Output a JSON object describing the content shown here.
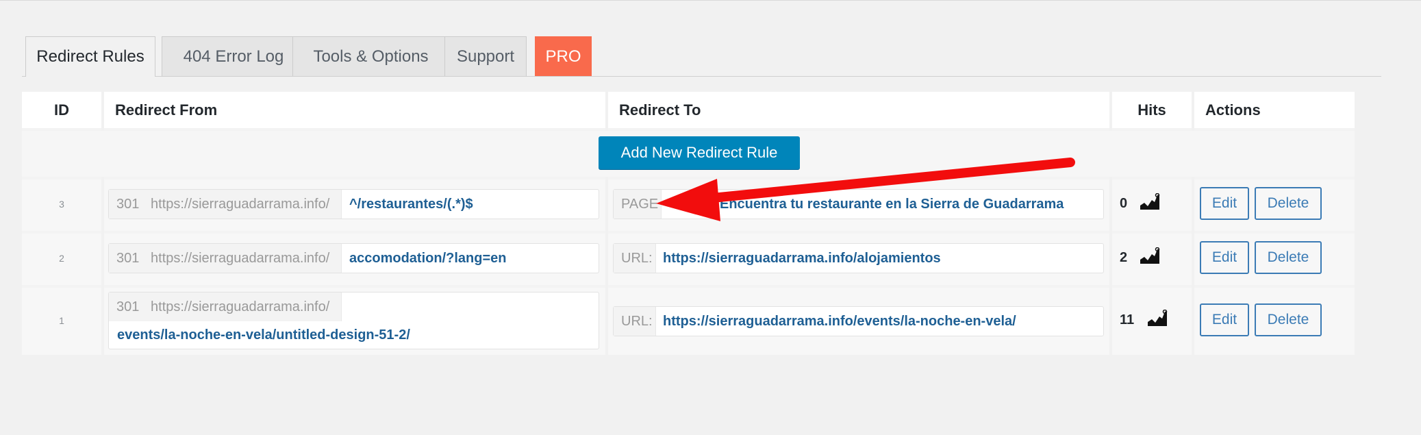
{
  "tabs": [
    {
      "label": "Redirect Rules",
      "active": true
    },
    {
      "label": "404 Error Log"
    },
    {
      "label": "Tools & Options"
    },
    {
      "label": "Support"
    },
    {
      "label": "PRO"
    }
  ],
  "table": {
    "headers": {
      "id": "ID",
      "from": "Redirect From",
      "to": "Redirect To",
      "hits": "Hits",
      "actions": "Actions"
    },
    "add_button": "Add New Redirect Rule",
    "rows": [
      {
        "id": "3",
        "status": "301",
        "base": "https://sierraguadarrama.info/",
        "from": "^/restaurantes/(.*)$",
        "to_type": "PAGE",
        "to": "Encuentra tu restaurante en la Sierra de Guadarrama",
        "hits": "0",
        "edit": "Edit",
        "delete": "Delete"
      },
      {
        "id": "2",
        "status": "301",
        "base": "https://sierraguadarrama.info/",
        "from": "accomodation/?lang=en",
        "to_type": "URL:",
        "to": "https://sierraguadarrama.info/alojamientos",
        "hits": "2",
        "edit": "Edit",
        "delete": "Delete"
      },
      {
        "id": "1",
        "status": "301",
        "base": "https://sierraguadarrama.info/",
        "from": "events/la-noche-en-vela/untitled-design-51-2/",
        "to_type": "URL:",
        "to": "https://sierraguadarrama.info/events/la-noche-en-vela/",
        "hits": "11",
        "edit": "Edit",
        "delete": "Delete"
      }
    ]
  },
  "colors": {
    "primary": "#0085ba",
    "pro": "#f96a4c",
    "link": "#1e5f94",
    "arrow": "#f20d0d"
  },
  "icons": [
    "stats-chart-icon"
  ]
}
